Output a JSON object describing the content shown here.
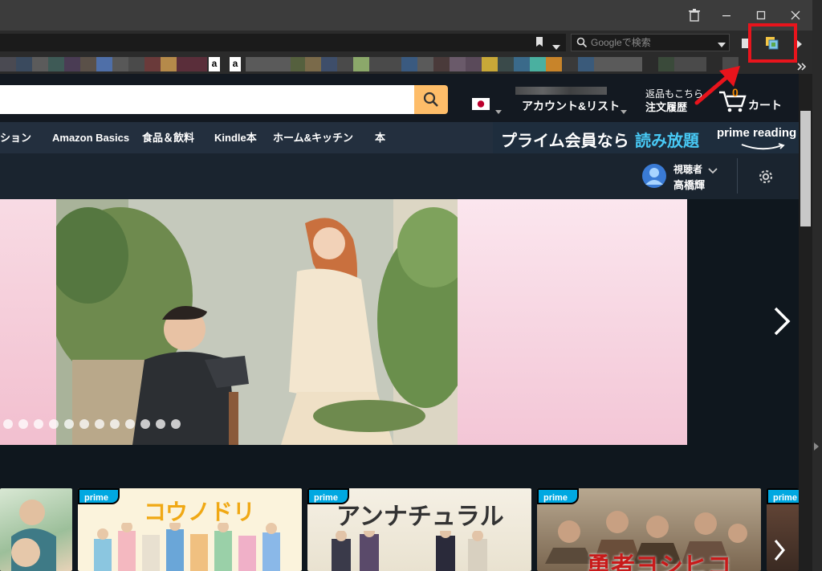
{
  "browser": {
    "search_placeholder": "Googleで検索",
    "icons": [
      "trash-icon",
      "minimize-icon",
      "maximize-icon",
      "close-icon",
      "bookmark-star-icon",
      "dropdown-icon",
      "search-icon",
      "extension-icon",
      "overflow-chevron-icon"
    ]
  },
  "amazon": {
    "header": {
      "language_flag": "JP",
      "account_label": "アカウント&リスト",
      "returns_top": "返品もこちら",
      "returns_bottom": "注文履歴",
      "cart_count": "0",
      "cart_label": "カート"
    },
    "nav": {
      "items": [
        "ション",
        "Amazon Basics",
        "食品＆飲料",
        "Kindle本",
        "ホーム&キッチン",
        "本"
      ],
      "promo_prefix": "プライム会員なら",
      "promo_highlight": "読み放題",
      "promo_logo": "prime reading"
    },
    "profile": {
      "role": "視聴者",
      "name": "高橋輝"
    },
    "row": {
      "cards": [
        {
          "badge": ""
        },
        {
          "badge": "prime",
          "title": "コウノドリ"
        },
        {
          "badge": "prime",
          "title": "アンナチュラル"
        },
        {
          "badge": "prime",
          "title": "勇者ヨシヒコ"
        },
        {
          "badge": "prime"
        }
      ]
    }
  },
  "colors": {
    "highlight": "#e8141c",
    "search_button": "#febd69",
    "prime_blue": "#00a8e1",
    "promo_blue": "#48c9f5"
  }
}
